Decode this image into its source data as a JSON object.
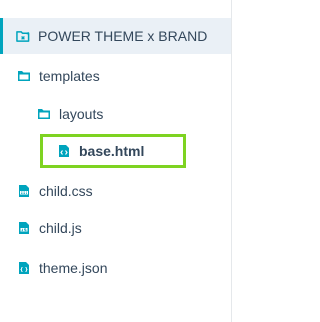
{
  "file_tree": {
    "root": {
      "label": "POWER THEME x BRAND",
      "icon": "theme-folder-icon"
    },
    "items": [
      {
        "label": "templates",
        "icon": "folder-icon"
      },
      {
        "label": "layouts",
        "icon": "folder-icon"
      },
      {
        "label": "base.html",
        "icon": "html-file-icon",
        "highlighted": true
      },
      {
        "label": "child.css",
        "icon": "css-file-icon"
      },
      {
        "label": "child.js",
        "icon": "js-file-icon"
      },
      {
        "label": "theme.json",
        "icon": "json-file-icon"
      }
    ]
  },
  "colors": {
    "icon": "#00a4bd",
    "text": "#33475b",
    "selected_bg": "#eaf0f6",
    "highlight_border": "#7ed321"
  }
}
